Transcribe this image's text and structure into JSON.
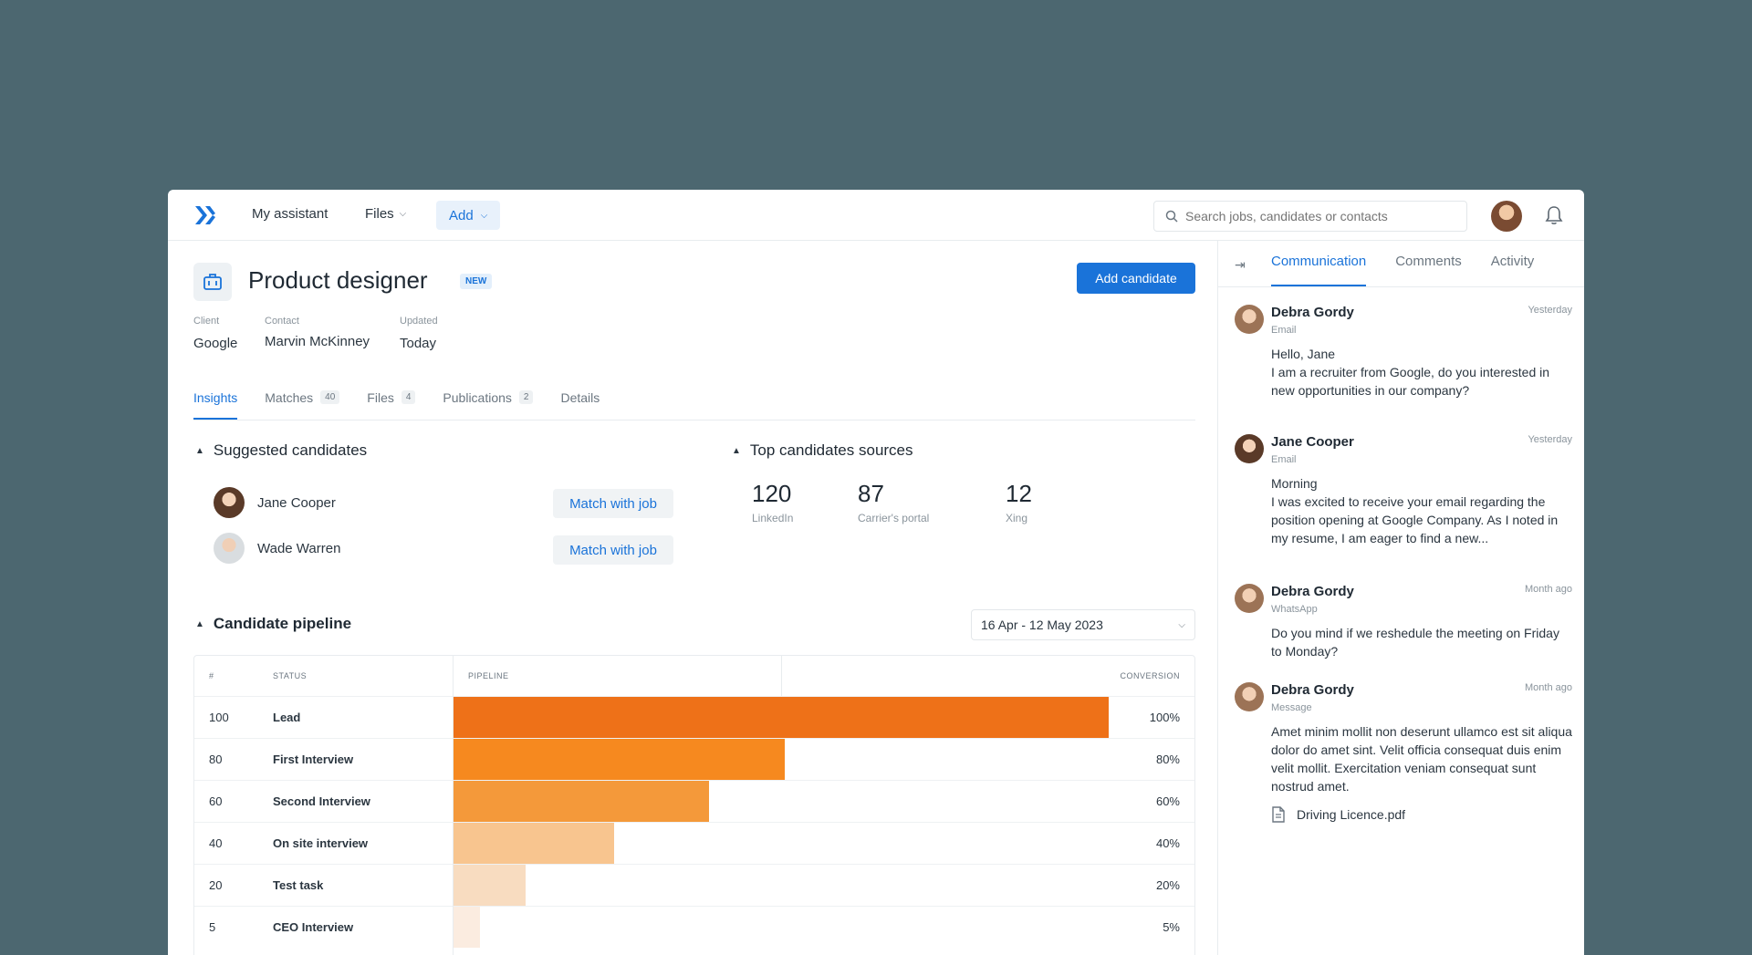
{
  "topbar": {
    "nav": [
      "My assistant",
      "Files"
    ],
    "add_label": "Add",
    "search_placeholder": "Search jobs, candidates or contacts"
  },
  "job": {
    "title": "Product designer",
    "badge": "NEW",
    "action_label": "Add candidate",
    "meta": [
      {
        "label": "Client",
        "value": "Google"
      },
      {
        "label": "Contact",
        "value": "Marvin McKinney"
      },
      {
        "label": "Updated",
        "value": "Today"
      }
    ]
  },
  "tabs": [
    {
      "label": "Insights",
      "count": ""
    },
    {
      "label": "Matches",
      "count": "40"
    },
    {
      "label": "Files",
      "count": "4"
    },
    {
      "label": "Publications",
      "count": "2"
    },
    {
      "label": "Details",
      "count": ""
    }
  ],
  "suggested": {
    "title": "Suggested candidates",
    "button_label": "Match with job",
    "candidates": [
      {
        "name": "Jane Cooper"
      },
      {
        "name": "Wade Warren"
      }
    ]
  },
  "sources": {
    "title": "Top candidates sources",
    "items": [
      {
        "count": "120",
        "name": "LinkedIn"
      },
      {
        "count": "87",
        "name": "Carrier's portal"
      },
      {
        "count": "12",
        "name": "Xing"
      }
    ]
  },
  "pipeline": {
    "title": "Candidate pipeline",
    "date_range": "16 Apr - 12 May 2023",
    "headers": {
      "num": "#",
      "status": "STATUS",
      "pipeline": "PIPELINE",
      "conversion": "CONVERSION"
    },
    "rows": [
      {
        "n": "100",
        "status": "Lead",
        "conversion": "100%",
        "fraction": 1.0,
        "color": "#ee7118"
      },
      {
        "n": "80",
        "status": "First Interview",
        "conversion": "80%",
        "fraction": 0.505,
        "color": "#f6891f"
      },
      {
        "n": "60",
        "status": "Second Interview",
        "conversion": "60%",
        "fraction": 0.39,
        "color": "#f4993a"
      },
      {
        "n": "40",
        "status": "On site interview",
        "conversion": "40%",
        "fraction": 0.245,
        "color": "#f8c58f"
      },
      {
        "n": "20",
        "status": "Test task",
        "conversion": "20%",
        "fraction": 0.11,
        "color": "#f8dcc0"
      },
      {
        "n": "5",
        "status": "CEO Interview",
        "conversion": "5%",
        "fraction": 0.04,
        "color": "#fbece0"
      }
    ]
  },
  "right_panel": {
    "tabs": [
      "Communication",
      "Comments",
      "Activity"
    ],
    "messages": [
      {
        "name": "Debra Gordy",
        "time": "Yesterday",
        "channel": "Email",
        "body": "Hello, Jane\nI am a recruiter from Google, do you interested in new opportunities in our company?"
      },
      {
        "name": "Jane Cooper",
        "time": "Yesterday",
        "channel": "Email",
        "body": "Morning\nI was excited to receive your email regarding the position opening at Google Company. As I noted in my resume, I am eager to find a new..."
      },
      {
        "name": "Debra Gordy",
        "time": "Month ago",
        "channel": "WhatsApp",
        "body": "Do you mind if we reshedule the meeting on Friday to Monday?"
      },
      {
        "name": "Debra Gordy",
        "time": "Month ago",
        "channel": "Message",
        "body": "Amet minim mollit non deserunt ullamco est sit aliqua dolor do amet sint. Velit officia consequat duis enim velit mollit. Exercitation veniam consequat sunt nostrud amet."
      }
    ],
    "attachment": "Driving Licence.pdf"
  }
}
